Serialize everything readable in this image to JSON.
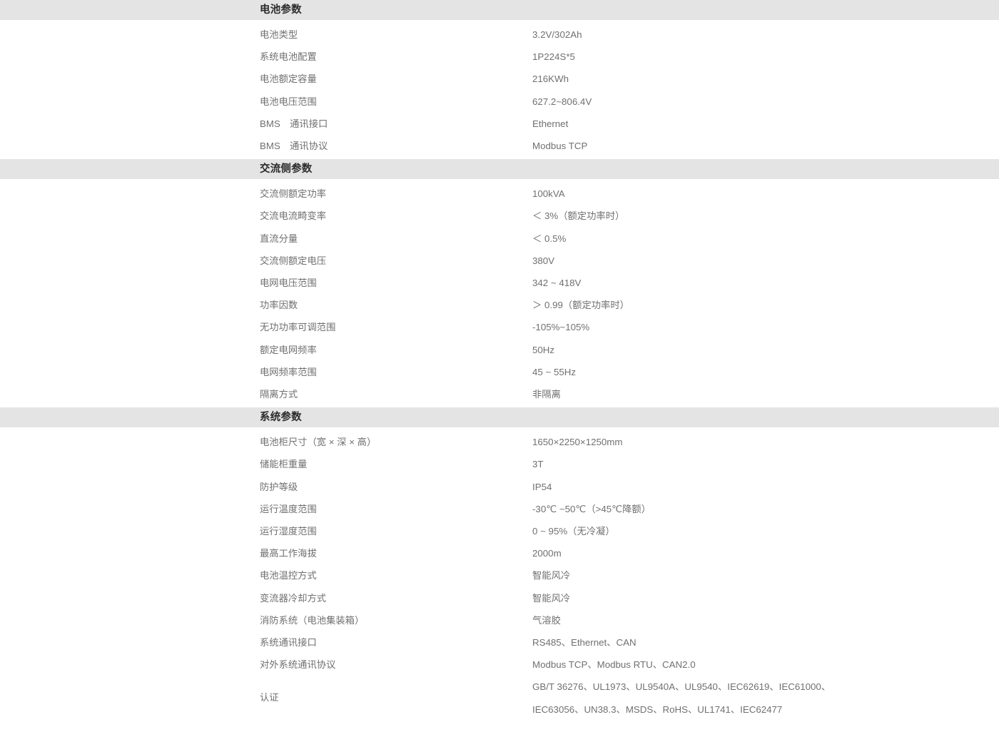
{
  "colors": {
    "band_background": "#e4e4e4",
    "page_background": "#ffffff",
    "title_text": "#2b2b2b",
    "body_text": "#707070"
  },
  "sections": [
    {
      "id": "battery-parameters",
      "title": "电池参数",
      "rows": [
        {
          "label": "电池类型",
          "value": "3.2V/302Ah"
        },
        {
          "label": "系统电池配置",
          "value": "1P224S*5"
        },
        {
          "label": "电池额定容量",
          "value": "216KWh"
        },
        {
          "label": "电池电压范围",
          "value": "627.2~806.4V"
        },
        {
          "label": "BMS　通讯接口",
          "value": "Ethernet"
        },
        {
          "label": "BMS　通讯协议",
          "value": "Modbus TCP"
        }
      ]
    },
    {
      "id": "ac-side-parameters",
      "title": "交流侧参数",
      "rows": [
        {
          "label": "交流侧额定功率",
          "value": "100kVA"
        },
        {
          "label": "交流电流畸变率",
          "value": "＜ 3%（额定功率时）"
        },
        {
          "label": "直流分量",
          "value": "＜ 0.5%"
        },
        {
          "label": "交流侧额定电压",
          "value": "380V"
        },
        {
          "label": "电网电压范围",
          "value": "342 ~ 418V"
        },
        {
          "label": "功率因数",
          "value": "＞ 0.99（额定功率时）"
        },
        {
          "label": "无功功率可调范围",
          "value": "-105%~105%"
        },
        {
          "label": "额定电网频率",
          "value": "50Hz"
        },
        {
          "label": "电网频率范围",
          "value": "45 ~ 55Hz"
        },
        {
          "label": "隔离方式",
          "value": "非隔离"
        }
      ]
    },
    {
      "id": "system-parameters",
      "title": "系统参数",
      "rows": [
        {
          "label": "电池柜尺寸（宽 × 深 × 高）",
          "value": "1650×2250×1250mm"
        },
        {
          "label": "储能柜重量",
          "value": "3T"
        },
        {
          "label": "防护等级",
          "value": "IP54"
        },
        {
          "label": "运行温度范围",
          "value": "-30℃ ~50℃（>45℃降额）"
        },
        {
          "label": "运行湿度范围",
          "value": "0 ~ 95%（无冷凝）"
        },
        {
          "label": "最高工作海拔",
          "value": "2000m"
        },
        {
          "label": "电池温控方式",
          "value": "智能风冷"
        },
        {
          "label": "变流器冷却方式",
          "value": "智能风冷"
        },
        {
          "label": "消防系统（电池集装箱）",
          "value": "气溶胶"
        },
        {
          "label": "系统通讯接口",
          "value": "RS485、Ethernet、CAN"
        },
        {
          "label": "对外系统通讯协议",
          "value": "Modbus TCP、Modbus RTU、CAN2.0"
        },
        {
          "label": "认证",
          "value_lines": [
            "GB/T 36276、UL1973、UL9540A、UL9540、IEC62619、IEC61000、",
            "IEC63056、UN38.3、MSDS、RoHS、UL1741、IEC62477"
          ]
        }
      ]
    }
  ]
}
